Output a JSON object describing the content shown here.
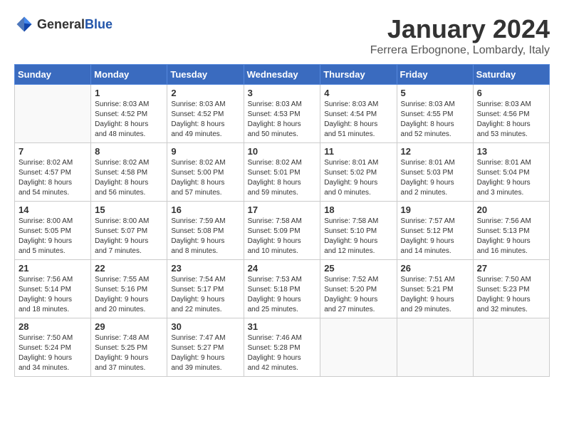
{
  "logo": {
    "text_general": "General",
    "text_blue": "Blue"
  },
  "title": "January 2024",
  "location": "Ferrera Erbognone, Lombardy, Italy",
  "days_of_week": [
    "Sunday",
    "Monday",
    "Tuesday",
    "Wednesday",
    "Thursday",
    "Friday",
    "Saturday"
  ],
  "weeks": [
    [
      {
        "day": "",
        "info": ""
      },
      {
        "day": "1",
        "info": "Sunrise: 8:03 AM\nSunset: 4:52 PM\nDaylight: 8 hours\nand 48 minutes."
      },
      {
        "day": "2",
        "info": "Sunrise: 8:03 AM\nSunset: 4:52 PM\nDaylight: 8 hours\nand 49 minutes."
      },
      {
        "day": "3",
        "info": "Sunrise: 8:03 AM\nSunset: 4:53 PM\nDaylight: 8 hours\nand 50 minutes."
      },
      {
        "day": "4",
        "info": "Sunrise: 8:03 AM\nSunset: 4:54 PM\nDaylight: 8 hours\nand 51 minutes."
      },
      {
        "day": "5",
        "info": "Sunrise: 8:03 AM\nSunset: 4:55 PM\nDaylight: 8 hours\nand 52 minutes."
      },
      {
        "day": "6",
        "info": "Sunrise: 8:03 AM\nSunset: 4:56 PM\nDaylight: 8 hours\nand 53 minutes."
      }
    ],
    [
      {
        "day": "7",
        "info": "Sunrise: 8:02 AM\nSunset: 4:57 PM\nDaylight: 8 hours\nand 54 minutes."
      },
      {
        "day": "8",
        "info": "Sunrise: 8:02 AM\nSunset: 4:58 PM\nDaylight: 8 hours\nand 56 minutes."
      },
      {
        "day": "9",
        "info": "Sunrise: 8:02 AM\nSunset: 5:00 PM\nDaylight: 8 hours\nand 57 minutes."
      },
      {
        "day": "10",
        "info": "Sunrise: 8:02 AM\nSunset: 5:01 PM\nDaylight: 8 hours\nand 59 minutes."
      },
      {
        "day": "11",
        "info": "Sunrise: 8:01 AM\nSunset: 5:02 PM\nDaylight: 9 hours\nand 0 minutes."
      },
      {
        "day": "12",
        "info": "Sunrise: 8:01 AM\nSunset: 5:03 PM\nDaylight: 9 hours\nand 2 minutes."
      },
      {
        "day": "13",
        "info": "Sunrise: 8:01 AM\nSunset: 5:04 PM\nDaylight: 9 hours\nand 3 minutes."
      }
    ],
    [
      {
        "day": "14",
        "info": "Sunrise: 8:00 AM\nSunset: 5:05 PM\nDaylight: 9 hours\nand 5 minutes."
      },
      {
        "day": "15",
        "info": "Sunrise: 8:00 AM\nSunset: 5:07 PM\nDaylight: 9 hours\nand 7 minutes."
      },
      {
        "day": "16",
        "info": "Sunrise: 7:59 AM\nSunset: 5:08 PM\nDaylight: 9 hours\nand 8 minutes."
      },
      {
        "day": "17",
        "info": "Sunrise: 7:58 AM\nSunset: 5:09 PM\nDaylight: 9 hours\nand 10 minutes."
      },
      {
        "day": "18",
        "info": "Sunrise: 7:58 AM\nSunset: 5:10 PM\nDaylight: 9 hours\nand 12 minutes."
      },
      {
        "day": "19",
        "info": "Sunrise: 7:57 AM\nSunset: 5:12 PM\nDaylight: 9 hours\nand 14 minutes."
      },
      {
        "day": "20",
        "info": "Sunrise: 7:56 AM\nSunset: 5:13 PM\nDaylight: 9 hours\nand 16 minutes."
      }
    ],
    [
      {
        "day": "21",
        "info": "Sunrise: 7:56 AM\nSunset: 5:14 PM\nDaylight: 9 hours\nand 18 minutes."
      },
      {
        "day": "22",
        "info": "Sunrise: 7:55 AM\nSunset: 5:16 PM\nDaylight: 9 hours\nand 20 minutes."
      },
      {
        "day": "23",
        "info": "Sunrise: 7:54 AM\nSunset: 5:17 PM\nDaylight: 9 hours\nand 22 minutes."
      },
      {
        "day": "24",
        "info": "Sunrise: 7:53 AM\nSunset: 5:18 PM\nDaylight: 9 hours\nand 25 minutes."
      },
      {
        "day": "25",
        "info": "Sunrise: 7:52 AM\nSunset: 5:20 PM\nDaylight: 9 hours\nand 27 minutes."
      },
      {
        "day": "26",
        "info": "Sunrise: 7:51 AM\nSunset: 5:21 PM\nDaylight: 9 hours\nand 29 minutes."
      },
      {
        "day": "27",
        "info": "Sunrise: 7:50 AM\nSunset: 5:23 PM\nDaylight: 9 hours\nand 32 minutes."
      }
    ],
    [
      {
        "day": "28",
        "info": "Sunrise: 7:50 AM\nSunset: 5:24 PM\nDaylight: 9 hours\nand 34 minutes."
      },
      {
        "day": "29",
        "info": "Sunrise: 7:48 AM\nSunset: 5:25 PM\nDaylight: 9 hours\nand 37 minutes."
      },
      {
        "day": "30",
        "info": "Sunrise: 7:47 AM\nSunset: 5:27 PM\nDaylight: 9 hours\nand 39 minutes."
      },
      {
        "day": "31",
        "info": "Sunrise: 7:46 AM\nSunset: 5:28 PM\nDaylight: 9 hours\nand 42 minutes."
      },
      {
        "day": "",
        "info": ""
      },
      {
        "day": "",
        "info": ""
      },
      {
        "day": "",
        "info": ""
      }
    ]
  ]
}
